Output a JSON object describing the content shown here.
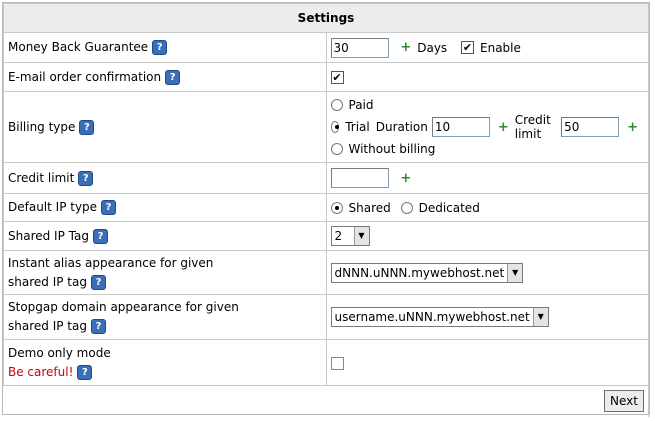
{
  "header": {
    "title": "Settings"
  },
  "rows": {
    "money_back": {
      "label": "Money Back Guarantee",
      "value": "30",
      "unit": "Days",
      "enable_label": "Enable",
      "enabled": true
    },
    "email_confirm": {
      "label": "E-mail order confirmation",
      "checked": true
    },
    "billing": {
      "label": "Billing type",
      "paid_label": "Paid",
      "trial_label": "Trial",
      "duration_label": "Duration",
      "duration_value": "10",
      "credit_limit_label": "Credit limit",
      "credit_limit_value": "50",
      "without_label": "Without billing",
      "selected": "Trial"
    },
    "credit_limit": {
      "label": "Credit limit",
      "value": ""
    },
    "ip_type": {
      "label": "Default IP type",
      "shared_label": "Shared",
      "dedicated_label": "Dedicated",
      "selected": "Shared"
    },
    "shared_ip_tag": {
      "label": "Shared IP Tag",
      "selected": "2"
    },
    "instant_alias": {
      "label_line1": "Instant alias appearance for given",
      "label_line2": "shared IP tag",
      "selected": "dNNN.uNNN.mywebhost.net"
    },
    "stopgap": {
      "label_line1": "Stopgap domain appearance for given",
      "label_line2": "shared IP tag",
      "selected": "username.uNNN.mywebhost.net"
    },
    "demo": {
      "label": "Demo only mode",
      "warning": "Be careful!",
      "checked": false
    }
  },
  "footer": {
    "next_label": "Next"
  },
  "icons": {
    "help": "help-question-icon",
    "add": "plus-icon"
  },
  "colors": {
    "add": "#2a8a2a",
    "help": "#3a6fb8",
    "warning": "#d00000"
  }
}
